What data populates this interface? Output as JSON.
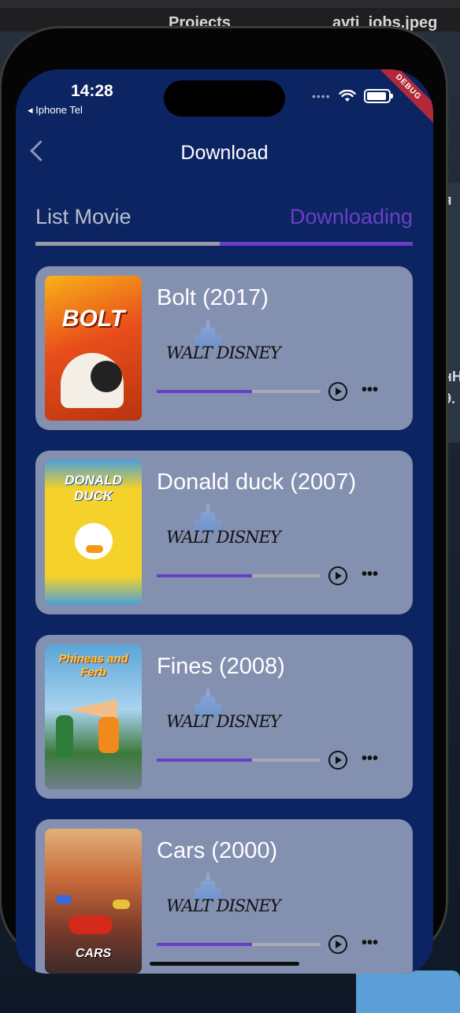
{
  "desktop": {
    "labels": [
      "Projects",
      "avti_jobs.jpeg"
    ],
    "side_panel_text": [
      "я",
      "нН",
      "9."
    ]
  },
  "status_bar": {
    "time": "14:28",
    "carrier": "◂ Iphone Tel",
    "debug_label": "DEBUG"
  },
  "app_bar": {
    "back_icon": "chevron-left-icon",
    "title": "Download"
  },
  "tabs": {
    "items": [
      {
        "label": "List Movie",
        "active": false
      },
      {
        "label": "Downloading",
        "active": true
      }
    ],
    "active_color": "#6a3fc7",
    "inactive_color": "#b9bfcf"
  },
  "movies": [
    {
      "title": "Bolt (2017)",
      "poster_text": "BOLT",
      "studio": "WALT DISNEY",
      "progress": 0.58,
      "poster_colors": [
        "#e94e1b",
        "#f7b21a"
      ]
    },
    {
      "title": "Donald duck (2007)",
      "poster_text": "DONALD DUCK",
      "studio": "WALT DISNEY",
      "progress": 0.58,
      "poster_colors": [
        "#f5d22a",
        "#4aa0d8"
      ]
    },
    {
      "title": "Fines (2008)",
      "poster_text": "Phineas and Ferb",
      "studio": "WALT DISNEY",
      "progress": 0.58,
      "poster_colors": [
        "#5aa6d8",
        "#3d7a3a"
      ]
    },
    {
      "title": "Cars (2000)",
      "poster_text": "CARS",
      "studio": "WALT DISNEY",
      "progress": 0.58,
      "poster_colors": [
        "#c96a3a",
        "#7a3a2a"
      ]
    }
  ],
  "actions": {
    "play_icon": "play-circle-icon",
    "more_icon": "more-horizontal-icon"
  },
  "colors": {
    "background": "#0c2461",
    "card": "#8390b0",
    "progress_fill": "#6a3fc7",
    "progress_track": "#a9a9b3"
  }
}
